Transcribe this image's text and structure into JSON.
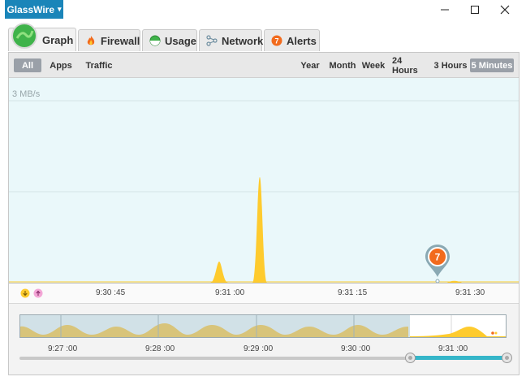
{
  "app": {
    "menu_label": "GlassWire",
    "menu_chevron": "▾"
  },
  "window_controls": {
    "minimize": "─",
    "maximize": "☐",
    "close": "✕"
  },
  "tabs": [
    {
      "label": "Graph",
      "icon": "graph-icon",
      "active": true
    },
    {
      "label": "Firewall",
      "icon": "flame-icon"
    },
    {
      "label": "Usage",
      "icon": "usage-icon"
    },
    {
      "label": "Network",
      "icon": "network-icon"
    },
    {
      "label": "Alerts",
      "icon": "alert-badge-icon",
      "badge": "7"
    }
  ],
  "filters": {
    "all": "All",
    "apps": "Apps",
    "traffic": "Traffic"
  },
  "ranges": {
    "year": "Year",
    "month": "Month",
    "week": "Week",
    "h24": "24 Hours",
    "h3": "3 Hours",
    "m5": "5 Minutes",
    "selected": "5 Minutes"
  },
  "graph": {
    "y_label": "3 MB/s",
    "ticks": [
      "9:30 :45",
      "9:31 :00",
      "9:31 :15",
      "9:31 :30"
    ],
    "alert_marker": "7",
    "download_icon": "download-arrow-icon",
    "upload_icon": "upload-arrow-icon"
  },
  "navigator": {
    "ticks": [
      "9:27 :00",
      "9:28 :00",
      "9:29 :00",
      "9:30 :00",
      "9:31 :00"
    ]
  },
  "colors": {
    "accent": "#1a85b9",
    "traffic": "#fecb2e",
    "chart_bg": "#eaf8fa",
    "alert": "#f26b1d",
    "selection": "#35b6c9"
  }
}
